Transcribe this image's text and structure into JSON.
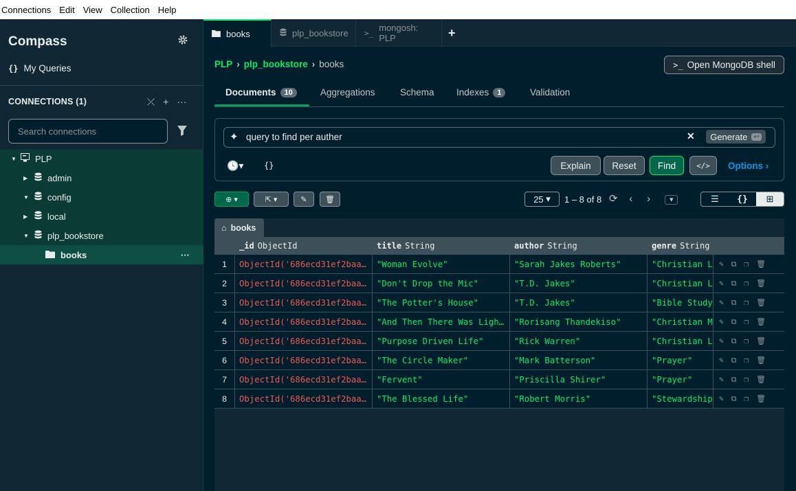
{
  "menu": [
    "Connections",
    "Edit",
    "View",
    "Collection",
    "Help"
  ],
  "sidebar": {
    "brand": "Compass",
    "my_queries": "My Queries",
    "connections_header": "CONNECTIONS (1)",
    "search_placeholder": "Search connections",
    "tree": [
      {
        "label": "PLP",
        "level": 0,
        "expanded": true,
        "icon": "server-icon"
      },
      {
        "label": "admin",
        "level": 1,
        "expanded": false,
        "icon": "database-icon"
      },
      {
        "label": "config",
        "level": 1,
        "expanded": true,
        "icon": "database-icon"
      },
      {
        "label": "local",
        "level": 1,
        "expanded": false,
        "icon": "database-icon"
      },
      {
        "label": "plp_bookstore",
        "level": 1,
        "expanded": true,
        "icon": "database-icon"
      },
      {
        "label": "books",
        "level": 2,
        "selected": true,
        "icon": "folder-icon"
      }
    ]
  },
  "tabs": [
    {
      "label": "books",
      "icon": "folder-icon",
      "active": true
    },
    {
      "label": "plp_bookstore",
      "icon": "database-icon",
      "active": false
    },
    {
      "label": "mongosh: PLP",
      "icon": "terminal-icon",
      "active": false
    }
  ],
  "breadcrumb": {
    "cluster": "PLP",
    "db": "plp_bookstore",
    "collection": "books"
  },
  "shell_button": "Open MongoDB shell",
  "subtabs": {
    "documents": "Documents",
    "documents_count": "10",
    "aggregations": "Aggregations",
    "schema": "Schema",
    "indexes": "Indexes",
    "indexes_count": "1",
    "validation": "Validation"
  },
  "query": {
    "ai_text": "query to find per auther",
    "generate": "Generate",
    "filter": "{}",
    "explain": "Explain",
    "reset": "Reset",
    "find": "Find",
    "options": "Options"
  },
  "pager": {
    "page_size": "25",
    "range": "1 – 8 of 8"
  },
  "grid": {
    "tab": "books",
    "columns": [
      {
        "name": "_id",
        "type": "ObjectId"
      },
      {
        "name": "title",
        "type": "String"
      },
      {
        "name": "author",
        "type": "String"
      },
      {
        "name": "genre",
        "type": "String"
      }
    ],
    "rows": [
      {
        "n": "1",
        "id": "ObjectId('686ecd31ef2baa…",
        "title": "\"Woman Evolve\"",
        "author": "\"Sarah Jakes Roberts\"",
        "genre": "\"Christian Li"
      },
      {
        "n": "2",
        "id": "ObjectId('686ecd31ef2baa…",
        "title": "\"Don't Drop the Mic\"",
        "author": "\"T.D. Jakes\"",
        "genre": "\"Christian Le"
      },
      {
        "n": "3",
        "id": "ObjectId('686ecd31ef2baa…",
        "title": "\"The Potter's House\"",
        "author": "\"T.D. Jakes\"",
        "genre": "\"Bible Study\""
      },
      {
        "n": "4",
        "id": "ObjectId('686ecd31ef2baa…",
        "title": "\"And Then There Was Ligh…",
        "author": "\"Rorisang Thandekiso\"",
        "genre": "\"Christian Mi"
      },
      {
        "n": "5",
        "id": "ObjectId('686ecd31ef2baa…",
        "title": "\"Purpose Driven Life\"",
        "author": "\"Rick Warren\"",
        "genre": "\"Christian Li"
      },
      {
        "n": "6",
        "id": "ObjectId('686ecd31ef2baa…",
        "title": "\"The Circle Maker\"",
        "author": "\"Mark Batterson\"",
        "genre": "\"Prayer\""
      },
      {
        "n": "7",
        "id": "ObjectId('686ecd31ef2baa…",
        "title": "\"Fervent\"",
        "author": "\"Priscilla Shirer\"",
        "genre": "\"Prayer\""
      },
      {
        "n": "8",
        "id": "ObjectId('686ecd31ef2baa…",
        "title": "\"The Blessed Life\"",
        "author": "\"Robert Morris\"",
        "genre": "\"Stewardship\""
      }
    ]
  },
  "colors": {
    "accent": "#00ed64",
    "objectid": "#ef5752",
    "link": "#0498ec"
  }
}
